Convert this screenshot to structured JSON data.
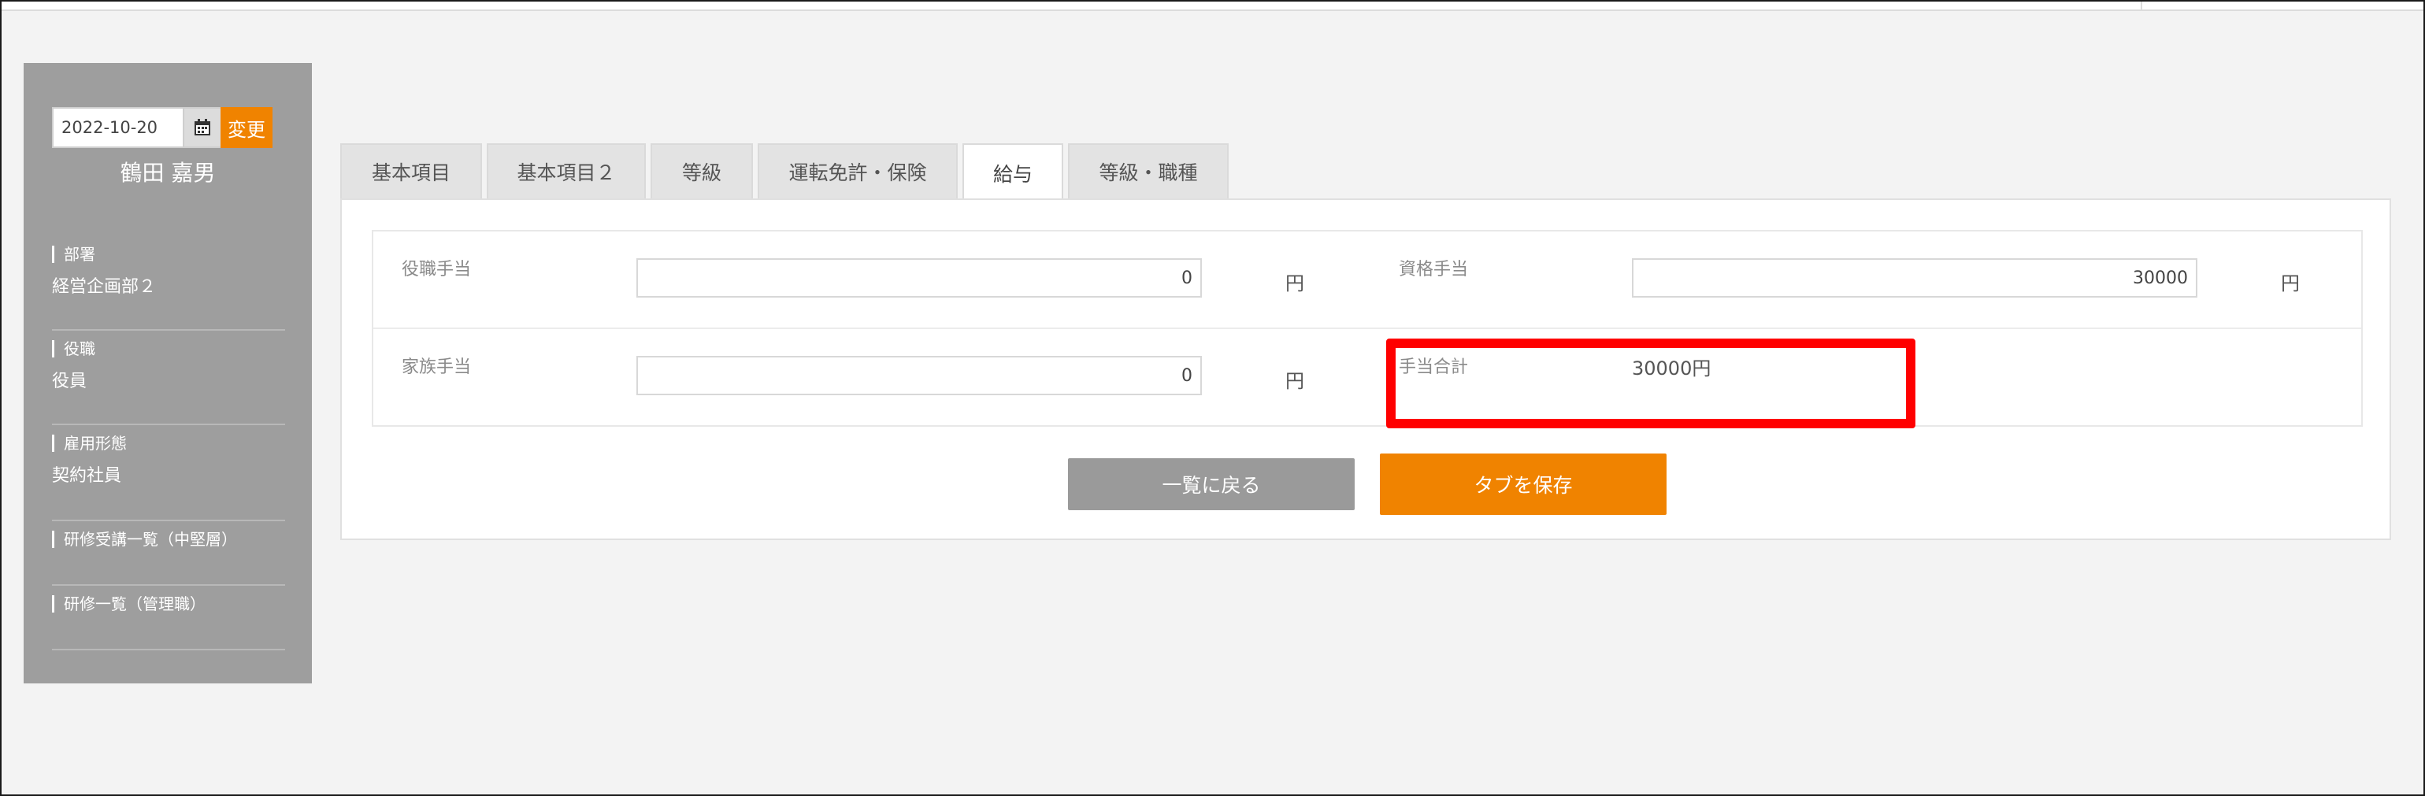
{
  "sidebar": {
    "date": "2022-10-20",
    "change_label": "変更",
    "user_name": "鶴田 嘉男",
    "items": [
      {
        "label": "部署",
        "value": "経営企画部２"
      },
      {
        "label": "役職",
        "value": "役員"
      },
      {
        "label": "雇用形態",
        "value": "契約社員"
      },
      {
        "label": "研修受講一覧（中堅層）"
      },
      {
        "label": "研修一覧（管理職）"
      }
    ]
  },
  "tabs": [
    {
      "label": "基本項目"
    },
    {
      "label": "基本項目２"
    },
    {
      "label": "等級"
    },
    {
      "label": "運転免許・保険"
    },
    {
      "label": "給与",
      "active": true
    },
    {
      "label": "等級・職種"
    }
  ],
  "form": {
    "yakushoku": {
      "label": "役職手当",
      "value": "0",
      "unit": "円"
    },
    "shikaku": {
      "label": "資格手当",
      "value": "30000",
      "unit": "円"
    },
    "kazoku": {
      "label": "家族手当",
      "value": "0",
      "unit": "円"
    },
    "total": {
      "label": "手当合計",
      "value": "30000円"
    }
  },
  "buttons": {
    "back_label": "一覧に戻る",
    "save_label": "タブを保存"
  },
  "colors": {
    "accent": "#f08300",
    "sidebar_bg": "#9e9e9e",
    "highlight": "#ff0000"
  }
}
